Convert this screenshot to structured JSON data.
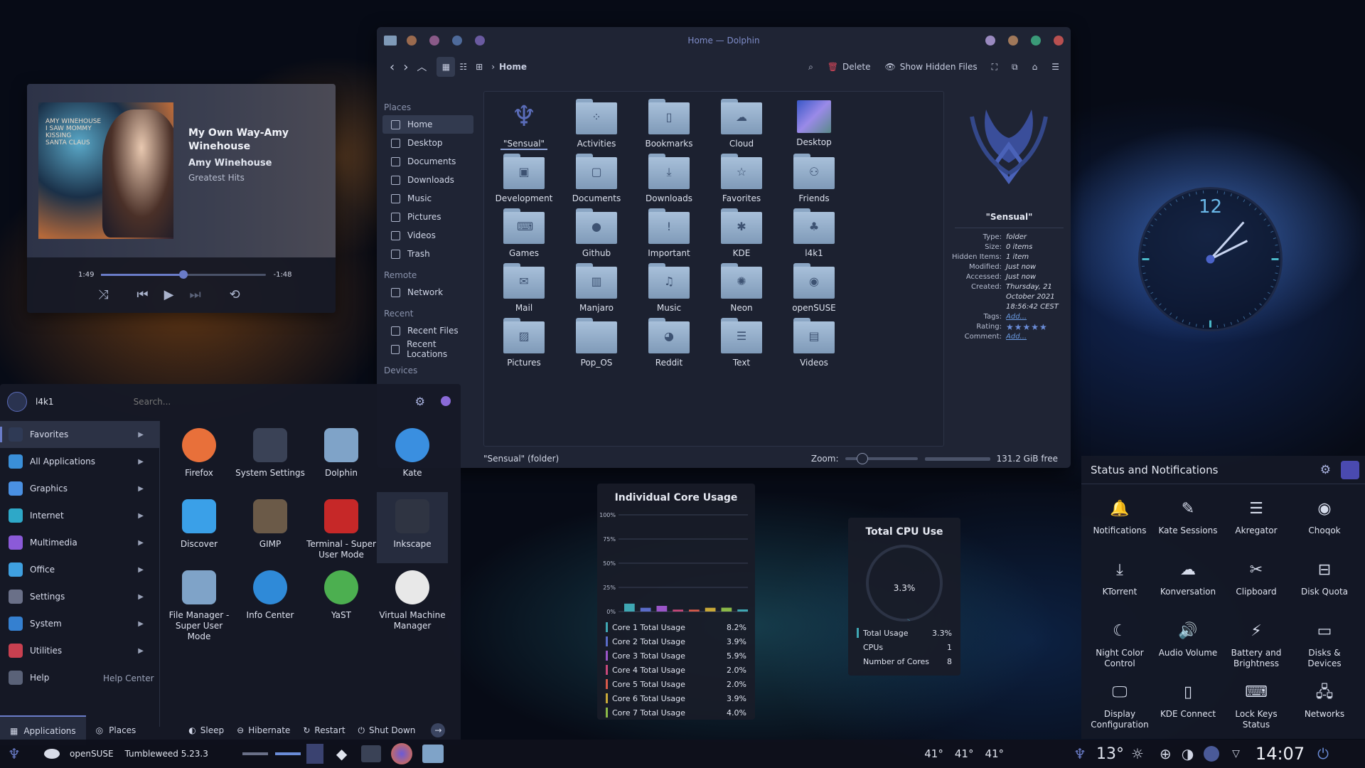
{
  "dolphin": {
    "title": "Home — Dolphin",
    "breadcrumb": "Home",
    "delete_label": "Delete",
    "show_hidden_label": "Show Hidden Files",
    "places_header": "Places",
    "places": [
      "Home",
      "Desktop",
      "Documents",
      "Downloads",
      "Music",
      "Pictures",
      "Videos",
      "Trash"
    ],
    "remote_header": "Remote",
    "remote": [
      "Network"
    ],
    "recent_header": "Recent",
    "recent": [
      "Recent Files",
      "Recent Locations"
    ],
    "devices_header": "Devices",
    "folders": [
      "\"Sensual\"",
      "Activities",
      "Bookmarks",
      "Cloud",
      "Desktop",
      "Development",
      "Documents",
      "Downloads",
      "Favorites",
      "Friends",
      "Games",
      "Github",
      "Important",
      "KDE",
      "l4k1",
      "Mail",
      "Manjaro",
      "Music",
      "Neon",
      "openSUSE",
      "Pictures",
      "Pop_OS",
      "Reddit",
      "Text",
      "Videos"
    ],
    "folder_icons": [
      "logo",
      "activities",
      "bookmark",
      "cloud",
      "desktop",
      "monitor",
      "doc",
      "download",
      "star",
      "people",
      "gamepad",
      "github",
      "exclaim",
      "kde",
      "l4k1",
      "mail",
      "manjaro",
      "music",
      "neon",
      "opensuse",
      "image",
      "popos",
      "reddit",
      "text",
      "film"
    ],
    "info": {
      "name": "\"Sensual\"",
      "rows": [
        {
          "k": "Type:",
          "v": "folder"
        },
        {
          "k": "Size:",
          "v": "0 items"
        },
        {
          "k": "Hidden Items:",
          "v": "1 item"
        },
        {
          "k": "Modified:",
          "v": "Just now"
        },
        {
          "k": "Accessed:",
          "v": "Just now"
        },
        {
          "k": "Created:",
          "v": "Thursday, 21 October 2021 18:56:42 CEST"
        },
        {
          "k": "Tags:",
          "v": "Add..."
        },
        {
          "k": "Rating:",
          "v": "★★★★★"
        },
        {
          "k": "Comment:",
          "v": "Add..."
        }
      ]
    },
    "status_text": "\"Sensual\" (folder)",
    "zoom_label": "Zoom:",
    "free_space": "131.2 GiB free"
  },
  "music": {
    "title": "My Own Way-Amy Winehouse",
    "artist": "Amy Winehouse",
    "album": "Greatest Hits",
    "cover_text": "AMY WINEHOUSE\nI SAW MOMMY\nKISSING\nSANTA CLAUS",
    "elapsed": "1:49",
    "remaining": "-1:48",
    "progress": 0.5
  },
  "launcher": {
    "user": "l4k1",
    "search_placeholder": "Search...",
    "categories": [
      "Favorites",
      "All Applications",
      "Graphics",
      "Internet",
      "Multimedia",
      "Office",
      "Settings",
      "System",
      "Utilities",
      "Help"
    ],
    "category_colors": [
      "#2f3a55",
      "#3a8fd8",
      "#4a90e2",
      "#2ea8c8",
      "#8b5ad8",
      "#3fa0e0",
      "#6a7088",
      "#3580d0",
      "#c84050",
      "#5a6278"
    ],
    "help_right": "Help Center",
    "apps": [
      "Firefox",
      "System Settings",
      "Dolphin",
      "Kate",
      "Discover",
      "GIMP",
      "Terminal - Super User Mode",
      "Inkscape",
      "File Manager - Super User Mode",
      "Info Center",
      "YaST",
      "Virtual Machine Manager"
    ],
    "app_colors": [
      "#e8703a",
      "#3a4256",
      "#7fa3c8",
      "#3a8fe0",
      "#3aa0e8",
      "#6b5a48",
      "#c62828",
      "#2f3442",
      "#7fa3c8",
      "#2f8ad8",
      "#4caf50",
      "#e8e8e8"
    ],
    "tabs": [
      "Applications",
      "Places"
    ],
    "actions": [
      "Sleep",
      "Hibernate",
      "Restart",
      "Shut Down"
    ]
  },
  "core": {
    "title": "Individual Core Usage",
    "yticks": [
      "100%",
      "75%",
      "50%",
      "25%",
      "0%"
    ],
    "rows": [
      {
        "label": "Core 1 Total Usage",
        "value": "8.2%",
        "color": "#3fa7b3"
      },
      {
        "label": "Core 2 Total Usage",
        "value": "3.9%",
        "color": "#5a6cc8"
      },
      {
        "label": "Core 3 Total Usage",
        "value": "5.9%",
        "color": "#9a55c8"
      },
      {
        "label": "Core 4 Total Usage",
        "value": "2.0%",
        "color": "#c8487a"
      },
      {
        "label": "Core 5 Total Usage",
        "value": "2.0%",
        "color": "#d85a4a"
      },
      {
        "label": "Core 6 Total Usage",
        "value": "3.9%",
        "color": "#c8a838"
      },
      {
        "label": "Core 7 Total Usage",
        "value": "4.0%",
        "color": "#8ab848"
      }
    ]
  },
  "cpu": {
    "title": "Total CPU Use",
    "value": "3.3%",
    "fraction": 0.033,
    "rows": [
      {
        "k": "Total Usage",
        "v": "3.3%"
      },
      {
        "k": "CPUs",
        "v": "1"
      },
      {
        "k": "Number of Cores",
        "v": "8"
      }
    ]
  },
  "clock": {
    "hour": 2,
    "minute": 7,
    "label": "12"
  },
  "statuspanel": {
    "title": "Status and Notifications",
    "items": [
      "Notifications",
      "Kate Sessions",
      "Akregator",
      "Choqok",
      "KTorrent",
      "Konversation",
      "Clipboard",
      "Disk Quota",
      "Night Color Control",
      "Audio Volume",
      "Battery and Brightness",
      "Disks & Devices",
      "Display Configuration",
      "KDE Connect",
      "Lock Keys Status",
      "Networks"
    ],
    "glyphs": [
      "🔔",
      "✎",
      "☰",
      "◉",
      "⤓",
      "☁",
      "✂",
      "⊟",
      "☾",
      "🔊",
      "⚡",
      "▭",
      "🖵",
      "▯",
      "⌨",
      "🖧"
    ]
  },
  "taskbar": {
    "distro": "openSUSE",
    "version": "Tumbleweed 5.23.3",
    "temps": [
      "41°",
      "41°",
      "41°"
    ],
    "weather": "13°",
    "time": "14:07"
  }
}
